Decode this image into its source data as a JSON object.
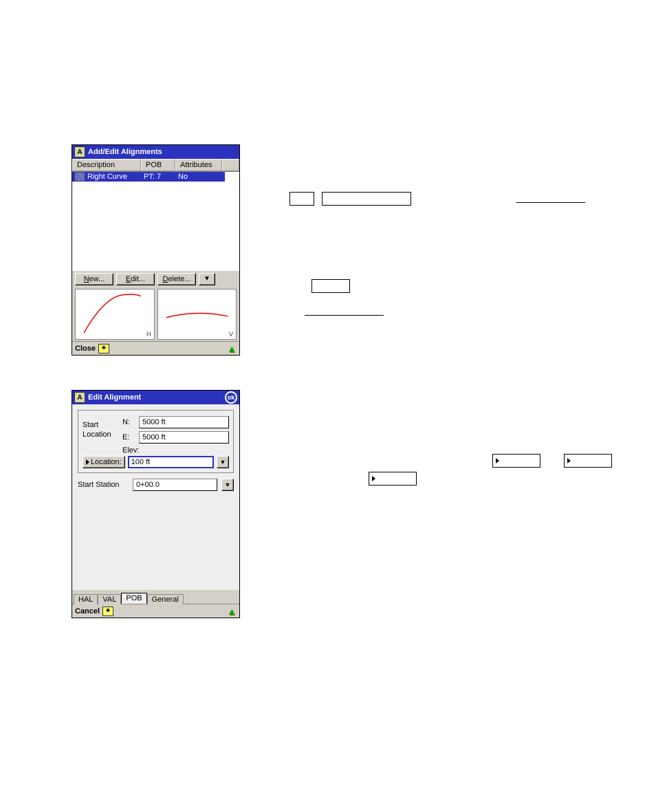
{
  "window1": {
    "title": "Add/Edit Alignments",
    "columns": {
      "desc": "Description",
      "pob": "POB",
      "attr": "Attributes"
    },
    "row": {
      "desc": "Right Curve",
      "pob": "PT: 7",
      "attr": "No"
    },
    "buttons": {
      "new": "New...",
      "edit": "Edit...",
      "delete": "Delete..."
    },
    "preview": {
      "h": "H",
      "v": "V"
    },
    "bottom": {
      "close": "Close"
    }
  },
  "window2": {
    "title": "Edit Alignment",
    "ok": "ok",
    "labels": {
      "start_location": "Start\nLocation",
      "n": "N:",
      "e": "E:",
      "elev": "Elev:",
      "location_btn": "Location:",
      "start_station": "Start Station"
    },
    "values": {
      "n": "5000 ft",
      "e": "5000 ft",
      "elev": "100 ft",
      "start_station": "0+00.0"
    },
    "tabs": {
      "hal": "HAL",
      "val": "VAL",
      "pob": "POB",
      "general": "General"
    },
    "bottom": {
      "cancel": "Cancel"
    }
  }
}
